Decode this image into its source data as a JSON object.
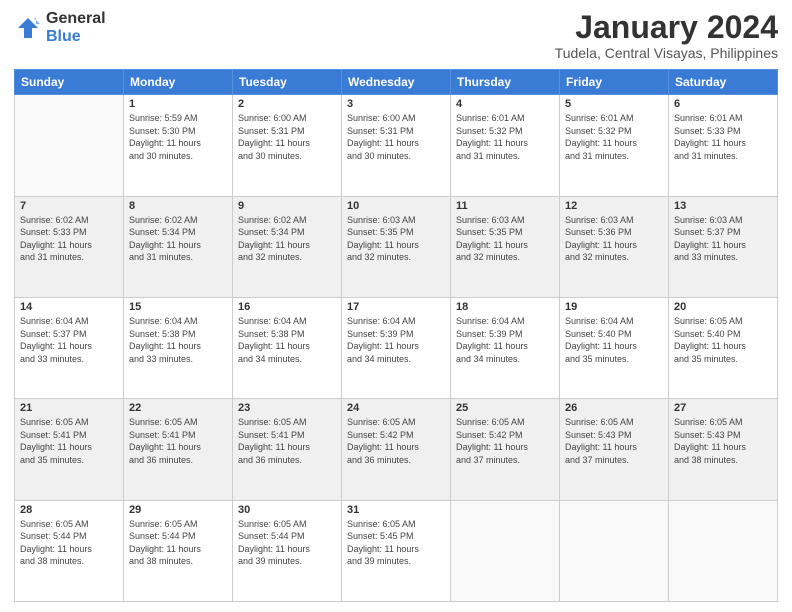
{
  "logo": {
    "general": "General",
    "blue": "Blue"
  },
  "header": {
    "month": "January 2024",
    "location": "Tudela, Central Visayas, Philippines"
  },
  "weekdays": [
    "Sunday",
    "Monday",
    "Tuesday",
    "Wednesday",
    "Thursday",
    "Friday",
    "Saturday"
  ],
  "weeks": [
    [
      {
        "day": "",
        "info": ""
      },
      {
        "day": "1",
        "info": "Sunrise: 5:59 AM\nSunset: 5:30 PM\nDaylight: 11 hours\nand 30 minutes."
      },
      {
        "day": "2",
        "info": "Sunrise: 6:00 AM\nSunset: 5:31 PM\nDaylight: 11 hours\nand 30 minutes."
      },
      {
        "day": "3",
        "info": "Sunrise: 6:00 AM\nSunset: 5:31 PM\nDaylight: 11 hours\nand 30 minutes."
      },
      {
        "day": "4",
        "info": "Sunrise: 6:01 AM\nSunset: 5:32 PM\nDaylight: 11 hours\nand 31 minutes."
      },
      {
        "day": "5",
        "info": "Sunrise: 6:01 AM\nSunset: 5:32 PM\nDaylight: 11 hours\nand 31 minutes."
      },
      {
        "day": "6",
        "info": "Sunrise: 6:01 AM\nSunset: 5:33 PM\nDaylight: 11 hours\nand 31 minutes."
      }
    ],
    [
      {
        "day": "7",
        "info": "Sunrise: 6:02 AM\nSunset: 5:33 PM\nDaylight: 11 hours\nand 31 minutes."
      },
      {
        "day": "8",
        "info": "Sunrise: 6:02 AM\nSunset: 5:34 PM\nDaylight: 11 hours\nand 31 minutes."
      },
      {
        "day": "9",
        "info": "Sunrise: 6:02 AM\nSunset: 5:34 PM\nDaylight: 11 hours\nand 32 minutes."
      },
      {
        "day": "10",
        "info": "Sunrise: 6:03 AM\nSunset: 5:35 PM\nDaylight: 11 hours\nand 32 minutes."
      },
      {
        "day": "11",
        "info": "Sunrise: 6:03 AM\nSunset: 5:35 PM\nDaylight: 11 hours\nand 32 minutes."
      },
      {
        "day": "12",
        "info": "Sunrise: 6:03 AM\nSunset: 5:36 PM\nDaylight: 11 hours\nand 32 minutes."
      },
      {
        "day": "13",
        "info": "Sunrise: 6:03 AM\nSunset: 5:37 PM\nDaylight: 11 hours\nand 33 minutes."
      }
    ],
    [
      {
        "day": "14",
        "info": "Sunrise: 6:04 AM\nSunset: 5:37 PM\nDaylight: 11 hours\nand 33 minutes."
      },
      {
        "day": "15",
        "info": "Sunrise: 6:04 AM\nSunset: 5:38 PM\nDaylight: 11 hours\nand 33 minutes."
      },
      {
        "day": "16",
        "info": "Sunrise: 6:04 AM\nSunset: 5:38 PM\nDaylight: 11 hours\nand 34 minutes."
      },
      {
        "day": "17",
        "info": "Sunrise: 6:04 AM\nSunset: 5:39 PM\nDaylight: 11 hours\nand 34 minutes."
      },
      {
        "day": "18",
        "info": "Sunrise: 6:04 AM\nSunset: 5:39 PM\nDaylight: 11 hours\nand 34 minutes."
      },
      {
        "day": "19",
        "info": "Sunrise: 6:04 AM\nSunset: 5:40 PM\nDaylight: 11 hours\nand 35 minutes."
      },
      {
        "day": "20",
        "info": "Sunrise: 6:05 AM\nSunset: 5:40 PM\nDaylight: 11 hours\nand 35 minutes."
      }
    ],
    [
      {
        "day": "21",
        "info": "Sunrise: 6:05 AM\nSunset: 5:41 PM\nDaylight: 11 hours\nand 35 minutes."
      },
      {
        "day": "22",
        "info": "Sunrise: 6:05 AM\nSunset: 5:41 PM\nDaylight: 11 hours\nand 36 minutes."
      },
      {
        "day": "23",
        "info": "Sunrise: 6:05 AM\nSunset: 5:41 PM\nDaylight: 11 hours\nand 36 minutes."
      },
      {
        "day": "24",
        "info": "Sunrise: 6:05 AM\nSunset: 5:42 PM\nDaylight: 11 hours\nand 36 minutes."
      },
      {
        "day": "25",
        "info": "Sunrise: 6:05 AM\nSunset: 5:42 PM\nDaylight: 11 hours\nand 37 minutes."
      },
      {
        "day": "26",
        "info": "Sunrise: 6:05 AM\nSunset: 5:43 PM\nDaylight: 11 hours\nand 37 minutes."
      },
      {
        "day": "27",
        "info": "Sunrise: 6:05 AM\nSunset: 5:43 PM\nDaylight: 11 hours\nand 38 minutes."
      }
    ],
    [
      {
        "day": "28",
        "info": "Sunrise: 6:05 AM\nSunset: 5:44 PM\nDaylight: 11 hours\nand 38 minutes."
      },
      {
        "day": "29",
        "info": "Sunrise: 6:05 AM\nSunset: 5:44 PM\nDaylight: 11 hours\nand 38 minutes."
      },
      {
        "day": "30",
        "info": "Sunrise: 6:05 AM\nSunset: 5:44 PM\nDaylight: 11 hours\nand 39 minutes."
      },
      {
        "day": "31",
        "info": "Sunrise: 6:05 AM\nSunset: 5:45 PM\nDaylight: 11 hours\nand 39 minutes."
      },
      {
        "day": "",
        "info": ""
      },
      {
        "day": "",
        "info": ""
      },
      {
        "day": "",
        "info": ""
      }
    ]
  ]
}
